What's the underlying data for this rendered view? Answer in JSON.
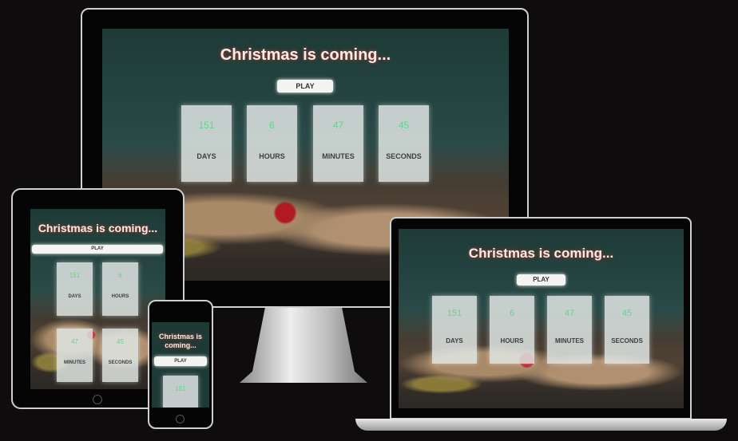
{
  "page": {
    "title": "Christmas is coming...",
    "play_label": "PLAY"
  },
  "countdown": [
    {
      "value": "151",
      "label": "DAYS"
    },
    {
      "value": "6",
      "label": "HOURS"
    },
    {
      "value": "47",
      "label": "MINUTES"
    },
    {
      "value": "45",
      "label": "SECONDS"
    }
  ],
  "colors": {
    "number": "#5fd68b",
    "background": "#1d3a36"
  }
}
